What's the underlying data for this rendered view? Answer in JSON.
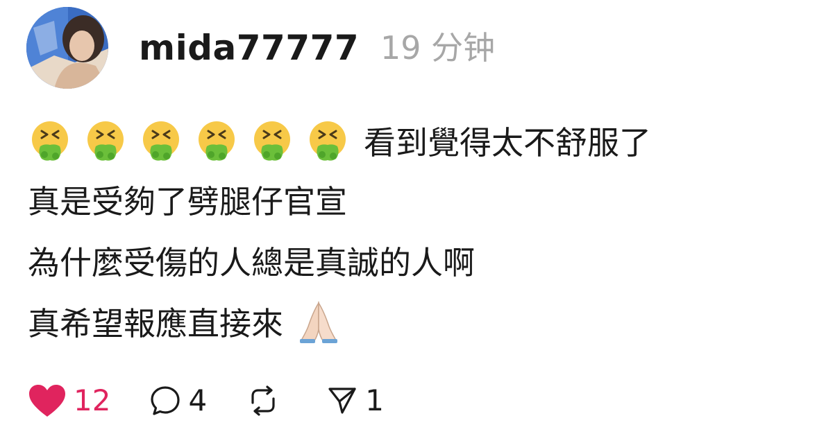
{
  "post": {
    "author": {
      "username": "mida77777",
      "avatar_icon": "profile-photo"
    },
    "timestamp": "19 分钟",
    "emoji_prefix": {
      "name": "vomiting-face-emoji",
      "count": 6
    },
    "lines": [
      "看到覺得太不舒服了",
      "真是受夠了劈腿仔官宣",
      "為什麼受傷的人總是真誠的人啊",
      "真希望報應直接來"
    ],
    "suffix_emoji": "folded-hands-emoji"
  },
  "actions": {
    "like": {
      "icon": "heart-icon",
      "count": "12",
      "color": "#e0245e"
    },
    "comment": {
      "icon": "comment-icon",
      "count": "4"
    },
    "repost": {
      "icon": "repost-icon",
      "count": ""
    },
    "share": {
      "icon": "send-icon",
      "count": "1"
    }
  }
}
